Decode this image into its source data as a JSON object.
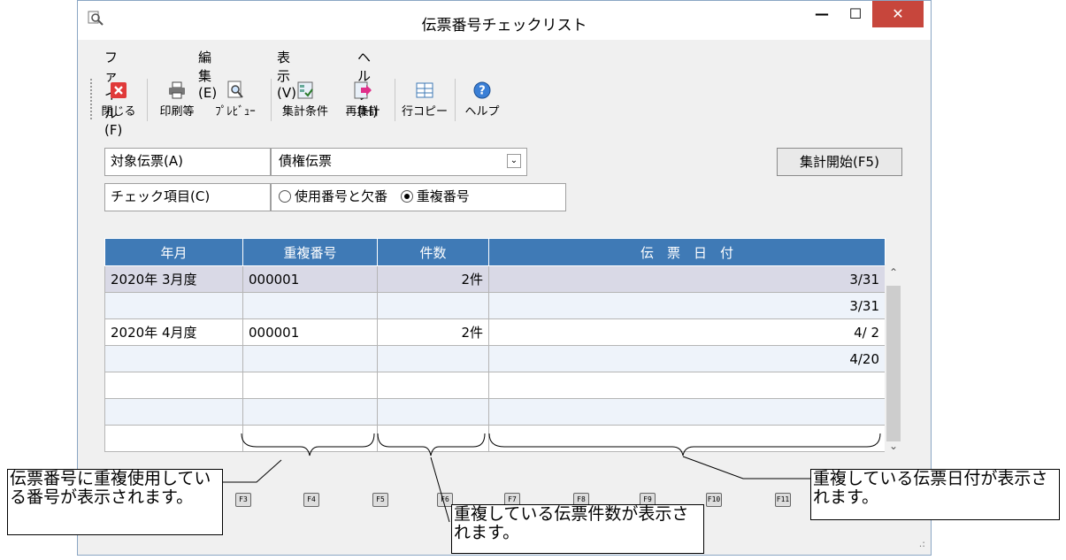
{
  "window": {
    "title": "伝票番号チェックリスト",
    "min": "—",
    "max": "☐",
    "close": "✕"
  },
  "menu": {
    "items": [
      "ファイル(F)",
      "編集(E)",
      "表示(V)",
      "ヘルプ(H)"
    ]
  },
  "toolbar": {
    "items": [
      {
        "label": "閉じる",
        "icon": "close-icon"
      },
      {
        "label": "印刷等",
        "icon": "printer-icon"
      },
      {
        "label": "ﾌﾟﾚﾋﾞｭｰ",
        "icon": "preview-icon"
      },
      {
        "label": "集計条件",
        "icon": "conditions-icon"
      },
      {
        "label": "再集計",
        "icon": "recalc-icon"
      },
      {
        "label": "行コピー",
        "icon": "row-copy-icon"
      },
      {
        "label": "ヘルプ",
        "icon": "help-icon"
      }
    ]
  },
  "form": {
    "target_label": "対象伝票(A)",
    "target_value": "債権伝票",
    "check_label": "チェック項目(C)",
    "option1": "使用番号と欠番",
    "option2": "重複番号",
    "selected_option": "重複番号",
    "start_button": "集計開始(F5)"
  },
  "table": {
    "headers": [
      "年月",
      "重複番号",
      "件数",
      "伝　票　日　付"
    ],
    "rows": [
      [
        "2020年 3月度",
        "000001",
        "2件",
        "3/31"
      ],
      [
        "",
        "",
        "",
        "3/31"
      ],
      [
        "2020年 4月度",
        "000001",
        "2件",
        "4/ 2"
      ],
      [
        "",
        "",
        "",
        "4/20"
      ],
      [
        "",
        "",
        "",
        ""
      ],
      [
        "",
        "",
        "",
        ""
      ],
      [
        "",
        "",
        "",
        ""
      ]
    ]
  },
  "fkeys": [
    "F3",
    "F4",
    "F5",
    "F6",
    "F7",
    "F8",
    "F9",
    "F10",
    "F11"
  ],
  "callouts": {
    "left": "伝票番号に重複使用している番号が表示されます。",
    "middle": "重複している伝票件数が表示されます。",
    "right": "重複している伝票日付が表示されます。"
  }
}
